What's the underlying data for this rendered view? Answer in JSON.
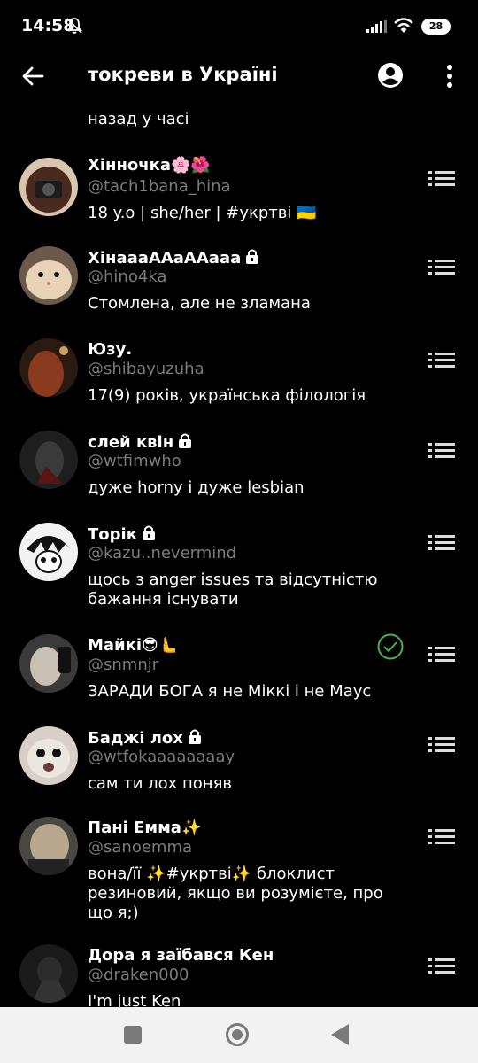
{
  "status_bar": {
    "time": "14:58",
    "battery": "28"
  },
  "app_bar": {
    "title": "токреви в Україні"
  },
  "previous_bio_tail": "назад у часі",
  "users": [
    {
      "name": "Хінночка🌸🌺",
      "handle": "@tach1bana_hina",
      "bio": "18 y.o | she/her | #укртві 🇺🇦",
      "locked": false,
      "following": false
    },
    {
      "name": "ХінаааААаААааа",
      "handle": "@hino4ka",
      "bio": "Стомлена, але не зламана",
      "locked": true,
      "following": false
    },
    {
      "name": "Юзу.",
      "handle": "@shibayuzuha",
      "bio": "17(9) років, українська філологія",
      "locked": false,
      "following": false
    },
    {
      "name": "слей квін",
      "handle": "@wtfimwho",
      "bio": "дуже horny і дуже lesbian",
      "locked": true,
      "following": false
    },
    {
      "name": "Торік",
      "handle": "@kazu..nevermind",
      "bio": "щось з anger issues та відсутністю бажання існувати",
      "locked": true,
      "following": false
    },
    {
      "name": "Майкі😎🫷",
      "handle": "@snmnjr",
      "bio": "ЗАРАДИ БОГА я не Міккі і не Маус",
      "locked": false,
      "following": true
    },
    {
      "name": "Баджі лох",
      "handle": "@wtfokaaaaaaaay",
      "bio": "сам ти лох поняв",
      "locked": true,
      "following": false
    },
    {
      "name": "Пані Емма✨",
      "handle": "@sanoemma",
      "bio": "вона/її ✨#укртві✨ блоклист резиновий, якщо ви розумієте, про що я;)",
      "locked": false,
      "following": false
    },
    {
      "name": "Дора я заїбався Кен",
      "handle": "@draken000",
      "bio": "I'm just Ken",
      "locked": false,
      "following": false
    }
  ],
  "colors": {
    "background": "#000000",
    "handle": "#7b7b7b",
    "accent_green": "#4caf50",
    "nav_bar": "#f2f2f2"
  }
}
